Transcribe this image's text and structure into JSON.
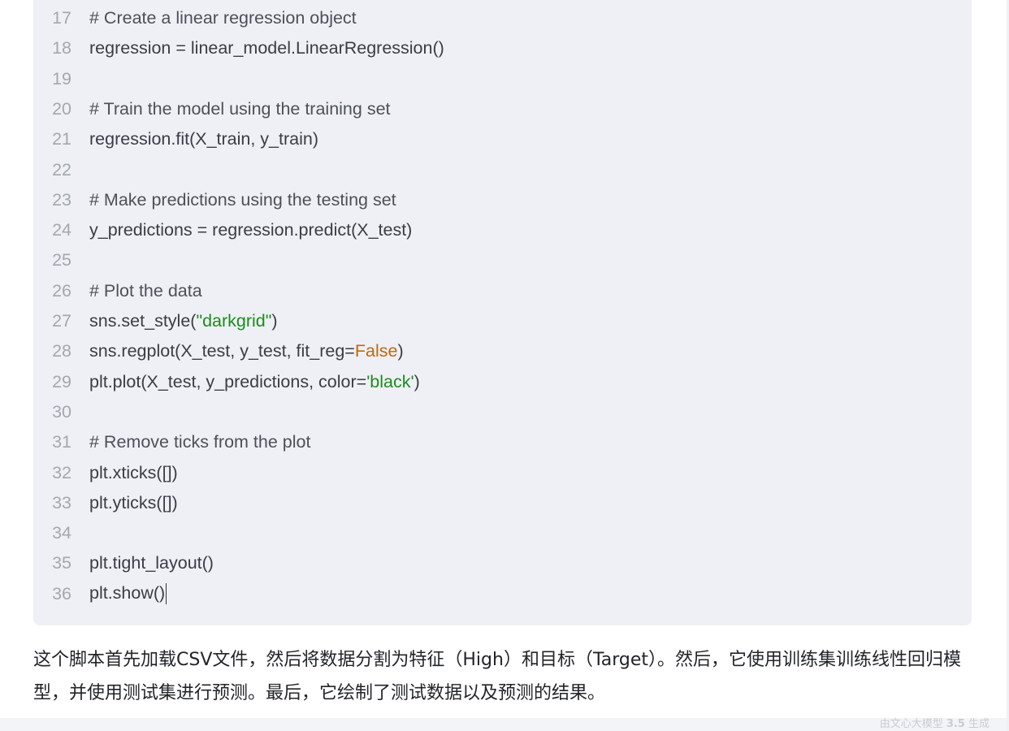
{
  "code": {
    "lines": [
      {
        "n": "17",
        "parts": [
          {
            "t": "# Create a linear regression object",
            "c": "comment"
          }
        ]
      },
      {
        "n": "18",
        "parts": [
          {
            "t": "regression = linear_model.LinearRegression()",
            "c": ""
          }
        ]
      },
      {
        "n": "19",
        "parts": []
      },
      {
        "n": "20",
        "parts": [
          {
            "t": "# Train the model using the training set",
            "c": "comment"
          }
        ]
      },
      {
        "n": "21",
        "parts": [
          {
            "t": "regression.fit(X_train, y_train)",
            "c": ""
          }
        ]
      },
      {
        "n": "22",
        "parts": []
      },
      {
        "n": "23",
        "parts": [
          {
            "t": "# Make predictions using the testing set",
            "c": "comment"
          }
        ]
      },
      {
        "n": "24",
        "parts": [
          {
            "t": "y_predictions = regression.predict(X_test)",
            "c": ""
          }
        ]
      },
      {
        "n": "25",
        "parts": []
      },
      {
        "n": "26",
        "parts": [
          {
            "t": "# Plot the data",
            "c": "comment"
          }
        ]
      },
      {
        "n": "27",
        "parts": [
          {
            "t": "sns.set_style(",
            "c": ""
          },
          {
            "t": "\"darkgrid\"",
            "c": "string"
          },
          {
            "t": ")",
            "c": ""
          }
        ]
      },
      {
        "n": "28",
        "parts": [
          {
            "t": "sns.regplot(X_test, y_test, fit_reg=",
            "c": ""
          },
          {
            "t": "False",
            "c": "keyword"
          },
          {
            "t": ")",
            "c": ""
          }
        ]
      },
      {
        "n": "29",
        "parts": [
          {
            "t": "plt.plot(X_test, y_predictions, color=",
            "c": ""
          },
          {
            "t": "'black'",
            "c": "string"
          },
          {
            "t": ")",
            "c": ""
          }
        ]
      },
      {
        "n": "30",
        "parts": []
      },
      {
        "n": "31",
        "parts": [
          {
            "t": "# Remove ticks from the plot",
            "c": "comment"
          }
        ]
      },
      {
        "n": "32",
        "parts": [
          {
            "t": "plt.xticks([])",
            "c": ""
          }
        ]
      },
      {
        "n": "33",
        "parts": [
          {
            "t": "plt.yticks([])",
            "c": ""
          }
        ]
      },
      {
        "n": "34",
        "parts": []
      },
      {
        "n": "35",
        "parts": [
          {
            "t": "plt.tight_layout()",
            "c": ""
          }
        ]
      },
      {
        "n": "36",
        "parts": [
          {
            "t": "plt.show()",
            "c": ""
          }
        ],
        "caret": true
      }
    ]
  },
  "explanation": "这个脚本首先加载CSV文件，然后将数据分割为特征（High）和目标（Target）。然后，它使用训练集训练线性回归模型，并使用测试集进行预测。最后，它绘制了测试数据以及预测的结果。",
  "watermark": {
    "prefix": "由文心大模型 ",
    "version": "3.5",
    "suffix": " 生成"
  },
  "colors": {
    "code_bg": "#eef0f5",
    "string": "#1f8a1f",
    "keyword": "#c06810",
    "line_number": "#a3a7b0"
  }
}
